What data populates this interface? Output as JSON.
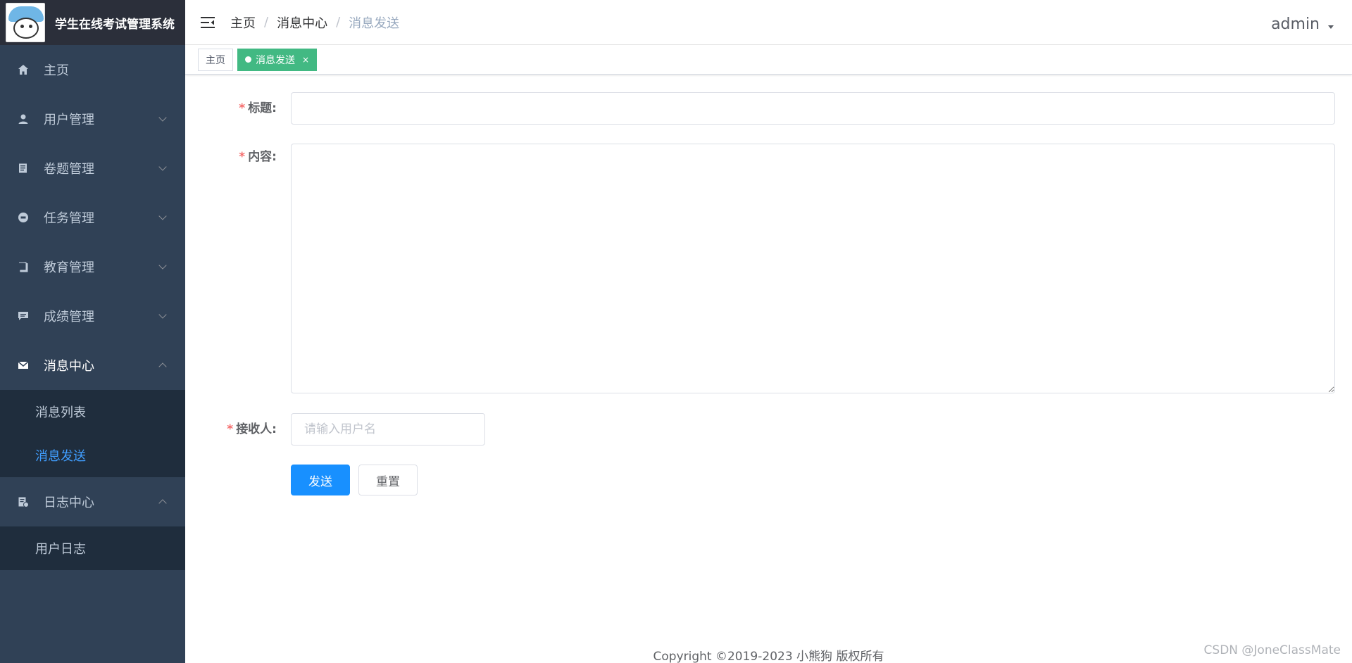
{
  "app": {
    "title": "学生在线考试管理系统"
  },
  "sidebar": {
    "items": [
      {
        "label": "主页",
        "icon": "home-icon"
      },
      {
        "label": "用户管理",
        "icon": "user-icon"
      },
      {
        "label": "卷题管理",
        "icon": "paper-icon"
      },
      {
        "label": "任务管理",
        "icon": "task-icon"
      },
      {
        "label": "教育管理",
        "icon": "book-icon"
      },
      {
        "label": "成绩管理",
        "icon": "chat-icon"
      },
      {
        "label": "消息中心",
        "icon": "mail-icon",
        "children": [
          "消息列表",
          "消息发送"
        ]
      },
      {
        "label": "日志中心",
        "icon": "log-icon",
        "children": [
          "用户日志"
        ]
      }
    ]
  },
  "header": {
    "breadcrumb": [
      "主页",
      "消息中心",
      "消息发送"
    ],
    "user": "admin"
  },
  "tags": {
    "home": "主页",
    "active": "消息发送",
    "close": "×"
  },
  "form": {
    "title_label": "标题:",
    "content_label": "内容:",
    "receiver_label": "接收人:",
    "required_mark": "*",
    "receiver_placeholder": "请输入用户名",
    "title_value": "",
    "content_value": "",
    "send_label": "发送",
    "reset_label": "重置"
  },
  "footer": {
    "copyright": "Copyright ©2019-2023 小熊狗 版权所有",
    "watermark": "CSDN @JoneClassMate"
  },
  "colors": {
    "sidebar_bg": "#304156",
    "submenu_bg": "#1f2d3d",
    "active_link": "#409eff",
    "tag_active": "#42b983",
    "primary": "#1890ff"
  }
}
